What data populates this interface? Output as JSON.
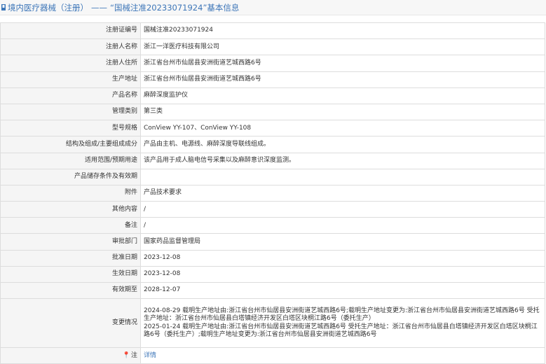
{
  "header": {
    "prefix": "境内医疗器械（注册）",
    "separator": "——",
    "title": "“国械注准20233071924”基本信息"
  },
  "rows": [
    {
      "label": "注册证编号",
      "value": "国械注准20233071924"
    },
    {
      "label": "注册人名称",
      "value": "浙江一洋医疗科技有限公司"
    },
    {
      "label": "注册人住所",
      "value": "浙江省台州市仙居县安洲街道艺城西路6号"
    },
    {
      "label": "生产地址",
      "value": "浙江省台州市仙居县安洲街道艺城西路6号"
    },
    {
      "label": "产品名称",
      "value": "麻醉深度监护仪"
    },
    {
      "label": "管理类别",
      "value": "第三类"
    },
    {
      "label": "型号规格",
      "value": "ConView YY-107、ConView YY-108"
    },
    {
      "label": "结构及组成/主要组成成分",
      "value": "产品由主机、电源线、麻醉深度导联线组成。"
    },
    {
      "label": "适用范围/预期用途",
      "value": "该产品用于成人脑电信号采集以及麻醉意识深度监测。"
    },
    {
      "label": "产品储存条件及有效期",
      "value": ""
    },
    {
      "label": "附件",
      "value": "产品技术要求"
    },
    {
      "label": "其他内容",
      "value": "/"
    },
    {
      "label": "备注",
      "value": "/"
    },
    {
      "label": "审批部门",
      "value": "国家药品监督管理局"
    },
    {
      "label": "批准日期",
      "value": "2023-12-08"
    },
    {
      "label": "生效日期",
      "value": "2023-12-08"
    },
    {
      "label": "有效期至",
      "value": "2028-12-07"
    }
  ],
  "change": {
    "label": "变更情况",
    "line1": "2024-08-29 载明生产地址由:浙江省台州市仙居县安洲街道艺城西路6号;载明生产地址变更为:浙江省台州市仙居县安洲街道艺城西路6号 受托生产地址：浙江省台州市仙居县白塔镇经济开发区白塔区块桐江路6号（委托生产）",
    "line2": "2025-01-24 载明生产地址由:浙江省台州市仙居县安洲街道艺城西路6号 受托生产地址：浙江省台州市仙居县白塔镇经济开发区白塔区块桐江路6号（委托生产）;载明生产地址变更为:浙江省台州市仙居县安洲街道艺城西路6号"
  },
  "note": {
    "label": "注",
    "link": "详情",
    "icon": "pin-icon"
  }
}
